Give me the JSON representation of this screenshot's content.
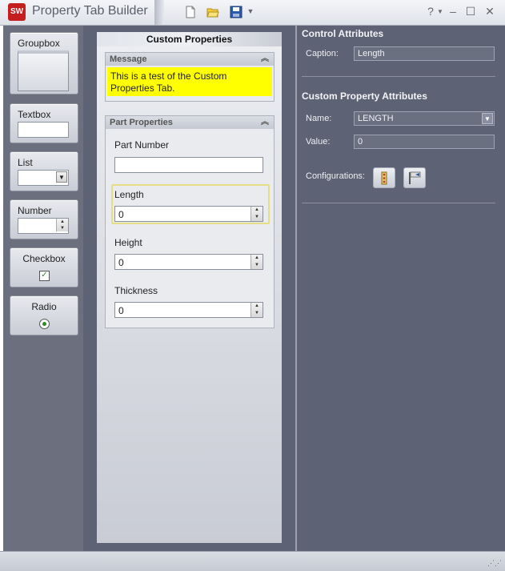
{
  "window": {
    "title": "Property Tab Builder",
    "logo_text": "SW",
    "help_label": "?",
    "controls": {
      "minimize": "–",
      "maximize": "☐",
      "close": "✕"
    }
  },
  "toolbox": {
    "items": [
      {
        "label": "Groupbox"
      },
      {
        "label": "Textbox"
      },
      {
        "label": "List"
      },
      {
        "label": "Number"
      },
      {
        "label": "Checkbox"
      },
      {
        "label": "Radio"
      }
    ]
  },
  "center": {
    "title": "Custom Properties",
    "message_group": {
      "header": "Message",
      "text": "This is a test of the Custom Properties Tab."
    },
    "part_group": {
      "header": "Part Properties",
      "fields": [
        {
          "label": "Part Number",
          "value": ""
        },
        {
          "label": "Length",
          "value": "0"
        },
        {
          "label": "Height",
          "value": "0"
        },
        {
          "label": "Thickness",
          "value": "0"
        }
      ]
    }
  },
  "attributes": {
    "control_header": "Control Attributes",
    "caption_label": "Caption:",
    "caption_value": "Length",
    "custom_header": "Custom Property Attributes",
    "name_label": "Name:",
    "name_value": "LENGTH",
    "value_label": "Value:",
    "value_value": "0",
    "config_label": "Configurations:"
  },
  "colors": {
    "background": "#5d6274",
    "message_highlight": "#ffff00",
    "brand": "#c41e1e"
  }
}
